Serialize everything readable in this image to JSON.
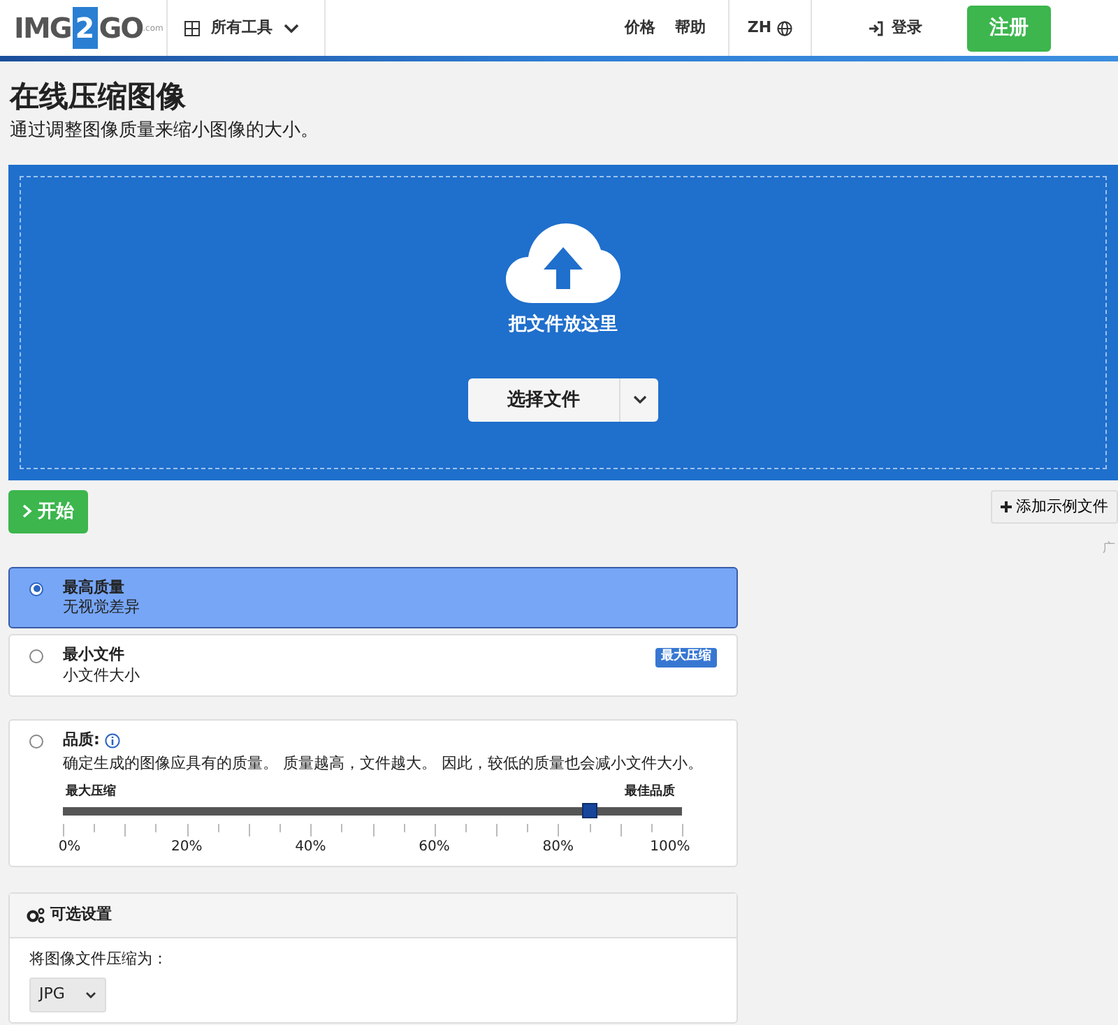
{
  "header": {
    "logo": {
      "left": "IMG",
      "digit": "2",
      "right": "GO",
      "suffix": ".com"
    },
    "tools_menu": "所有工具",
    "links": [
      "价格",
      "帮助"
    ],
    "language": "ZH",
    "login": "登录",
    "signup": "注册"
  },
  "page": {
    "title": "在线压缩图像",
    "subtitle": "通过调整图像质量来缩小图像的大小。"
  },
  "dropzone": {
    "hint": "把文件放这里",
    "choose_button": "选择文件"
  },
  "start_button": "开始",
  "sample_button": "添加示例文件",
  "ad_label": "广",
  "options": [
    {
      "kind": "preset",
      "title": "最高质量",
      "description": "无视觉差异",
      "selected": true
    },
    {
      "kind": "preset",
      "title": "最小文件",
      "description": "小文件大小",
      "badge": "最大压缩",
      "selected": false
    },
    {
      "kind": "slider",
      "title": "品质:",
      "description": "确定生成的图像应具有的质量。 质量越高，文件越大。 因此，较低的质量也会减小文件大小。",
      "min_label": "最大压缩",
      "max_label": "最佳品质",
      "level": 0.85,
      "tick_labels": [
        "0%",
        "20%",
        "40%",
        "60%",
        "80%",
        "100%"
      ],
      "selected": false
    }
  ],
  "settings": {
    "title": "可选设置",
    "format_label": "将图像文件压缩为：",
    "format_value": "JPG"
  }
}
